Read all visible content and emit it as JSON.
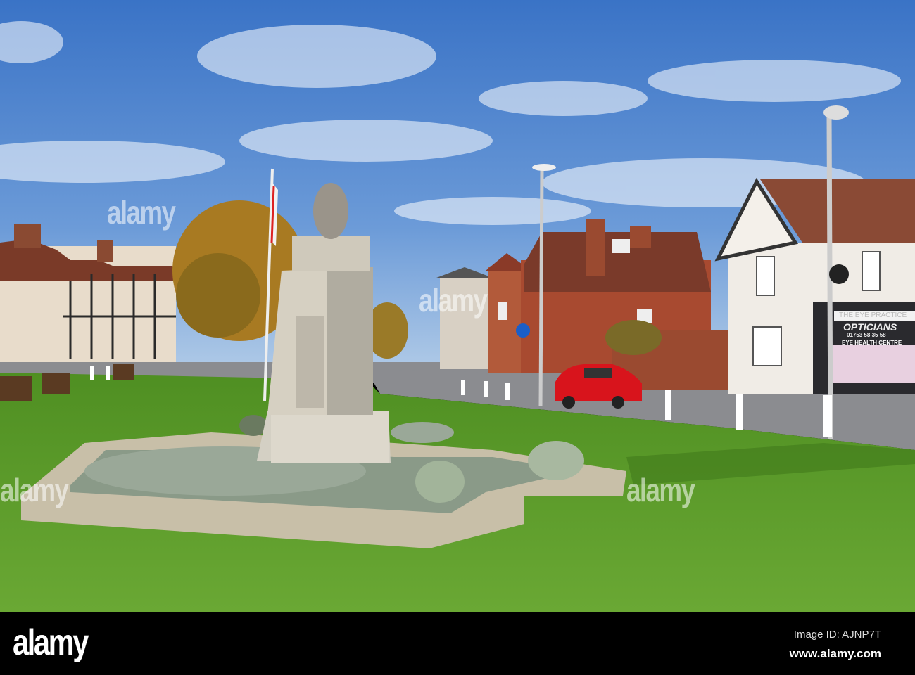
{
  "photo": {
    "shop_sign": {
      "top_line": "THE EYE PRACTICE",
      "name": "OPTICIANS",
      "phone": "01753 58 35 58",
      "subtitle": "EYE HEALTH CENTRE"
    },
    "watermark": "alamy"
  },
  "footer": {
    "logo": "alamy",
    "image_id": "Image ID: AJNP7T",
    "url": "www.alamy.com"
  },
  "colors": {
    "sky_top": "#3a73c6",
    "sky_low": "#b4cde8",
    "grass": "#5c9b2c",
    "road": "#8b8c90",
    "car": "#d8141c",
    "brick": "#9a4a30"
  }
}
